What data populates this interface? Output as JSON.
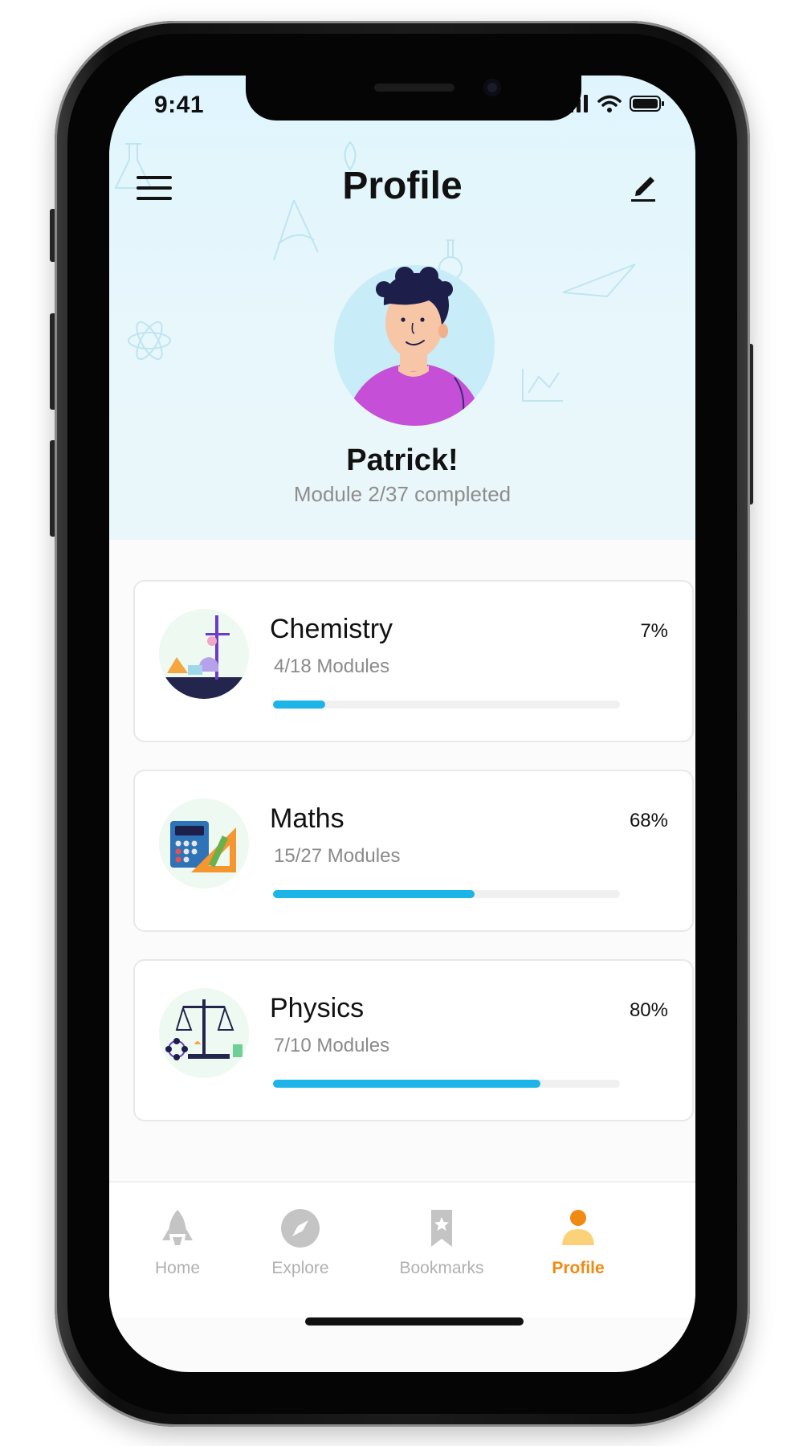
{
  "status_bar": {
    "time": "9:41"
  },
  "header": {
    "title": "Profile"
  },
  "user": {
    "name": "Patrick!",
    "progress_text": "Module 2/37 completed"
  },
  "courses": [
    {
      "title": "Chemistry",
      "modules": "4/18 Modules",
      "percent_label": "7%",
      "progress": 0.15
    },
    {
      "title": "Maths",
      "modules": "15/27 Modules",
      "percent_label": "68%",
      "progress": 0.58
    },
    {
      "title": "Physics",
      "modules": "7/10 Modules",
      "percent_label": "80%",
      "progress": 0.77
    }
  ],
  "tabs": [
    {
      "label": "Home",
      "icon": "rocket-icon",
      "active": false
    },
    {
      "label": "Explore",
      "icon": "compass-icon",
      "active": false
    },
    {
      "label": "Bookmarks",
      "icon": "bookmark-icon",
      "active": false
    },
    {
      "label": "Profile",
      "icon": "person-icon",
      "active": true
    }
  ],
  "colors": {
    "accent_blue": "#1db4e8",
    "active_tab": "#f08a12",
    "header_bg": "#dff5fd",
    "avatar_shirt": "#c54fd6"
  }
}
